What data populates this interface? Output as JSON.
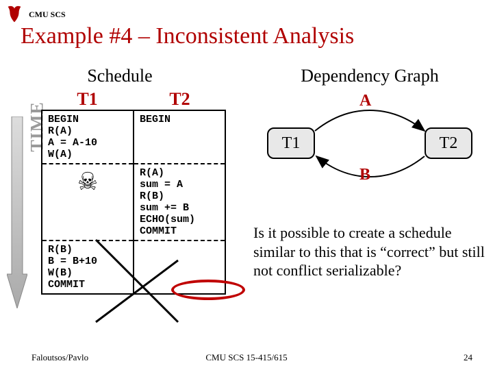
{
  "header": {
    "org": "CMU SCS"
  },
  "title": "Example #4 – Inconsistent Analysis",
  "time_label": "TIME",
  "schedule": {
    "title": "Schedule",
    "t1_label": "T1",
    "t2_label": "T2",
    "rows": {
      "r1c1": "BEGIN\nR(A)\nA = A-10\nW(A)",
      "r1c2": "BEGIN",
      "r2c1": "",
      "r2c2": "R(A)\nsum = A\nR(B)\nsum += B\nECHO(sum)\nCOMMIT",
      "r3c1": "R(B)\nB = B+10\nW(B)\nCOMMIT",
      "r3c2": ""
    }
  },
  "dep": {
    "title": "Dependency Graph",
    "nodeA": "T1",
    "nodeB": "T2",
    "edgeA": "A",
    "edgeB": "B"
  },
  "question": "Is it possible to create a schedule similar to this that is “correct” but still not conflict serializable?",
  "footer": {
    "left": "Faloutsos/Pavlo",
    "mid": "CMU SCS 15-415/615",
    "right": "24"
  }
}
